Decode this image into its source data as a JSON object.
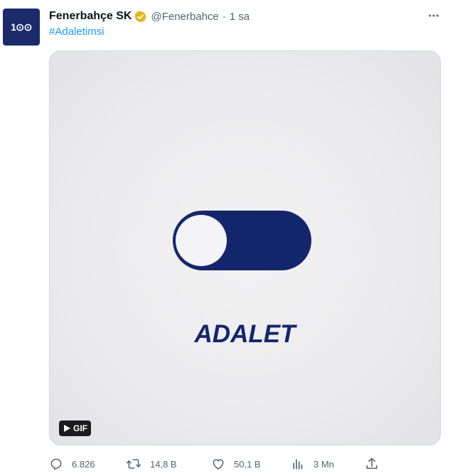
{
  "tweet": {
    "display_name": "Fenerbahçe SK",
    "handle": "@Fenerbahce",
    "separator": "·",
    "time": "1 sa",
    "hashtag": "#Adaletimsi",
    "avatar_text": "1⊙⊙",
    "verified_color": "#e2b719"
  },
  "media": {
    "caption_text": "ADALET",
    "gif_label": "GIF",
    "toggle_color": "#14266b"
  },
  "actions": {
    "replies": "6.826",
    "retweets": "14,8 B",
    "likes": "50,1 B",
    "views": "3 Mn"
  },
  "colors": {
    "link": "#1d9bf0",
    "muted": "#536471"
  }
}
